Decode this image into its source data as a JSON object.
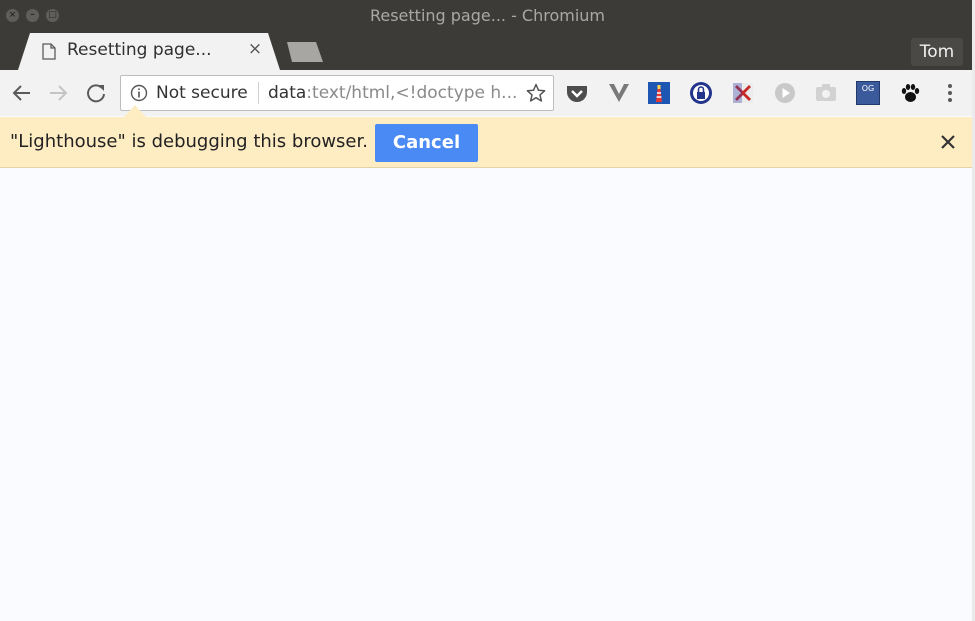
{
  "window": {
    "title": "Resetting page... - Chromium",
    "close_glyph": "×",
    "minimize_glyph": "–",
    "maximize_glyph": "□"
  },
  "tab": {
    "title": "Resetting page...",
    "close_glyph": "×"
  },
  "profile": {
    "name": "Tom"
  },
  "omnibox": {
    "security_label": "Not secure",
    "url_scheme": "data",
    "url_rest": ":text/html,<!doctype h..."
  },
  "extensions": [
    "pocket-icon",
    "vivaldi-icon",
    "lighthouse-icon",
    "lastpass-icon",
    "split-icon",
    "play-icon",
    "camera-icon",
    "og-icon",
    "paw-icon"
  ],
  "og_label": "OG",
  "infobar": {
    "message": "\"Lighthouse\" is debugging this browser.",
    "cancel_label": "Cancel",
    "close_glyph": "×"
  },
  "colors": {
    "accent": "#4a8af4",
    "infobar": "#feedc3",
    "titlebar": "#3c3b37"
  }
}
